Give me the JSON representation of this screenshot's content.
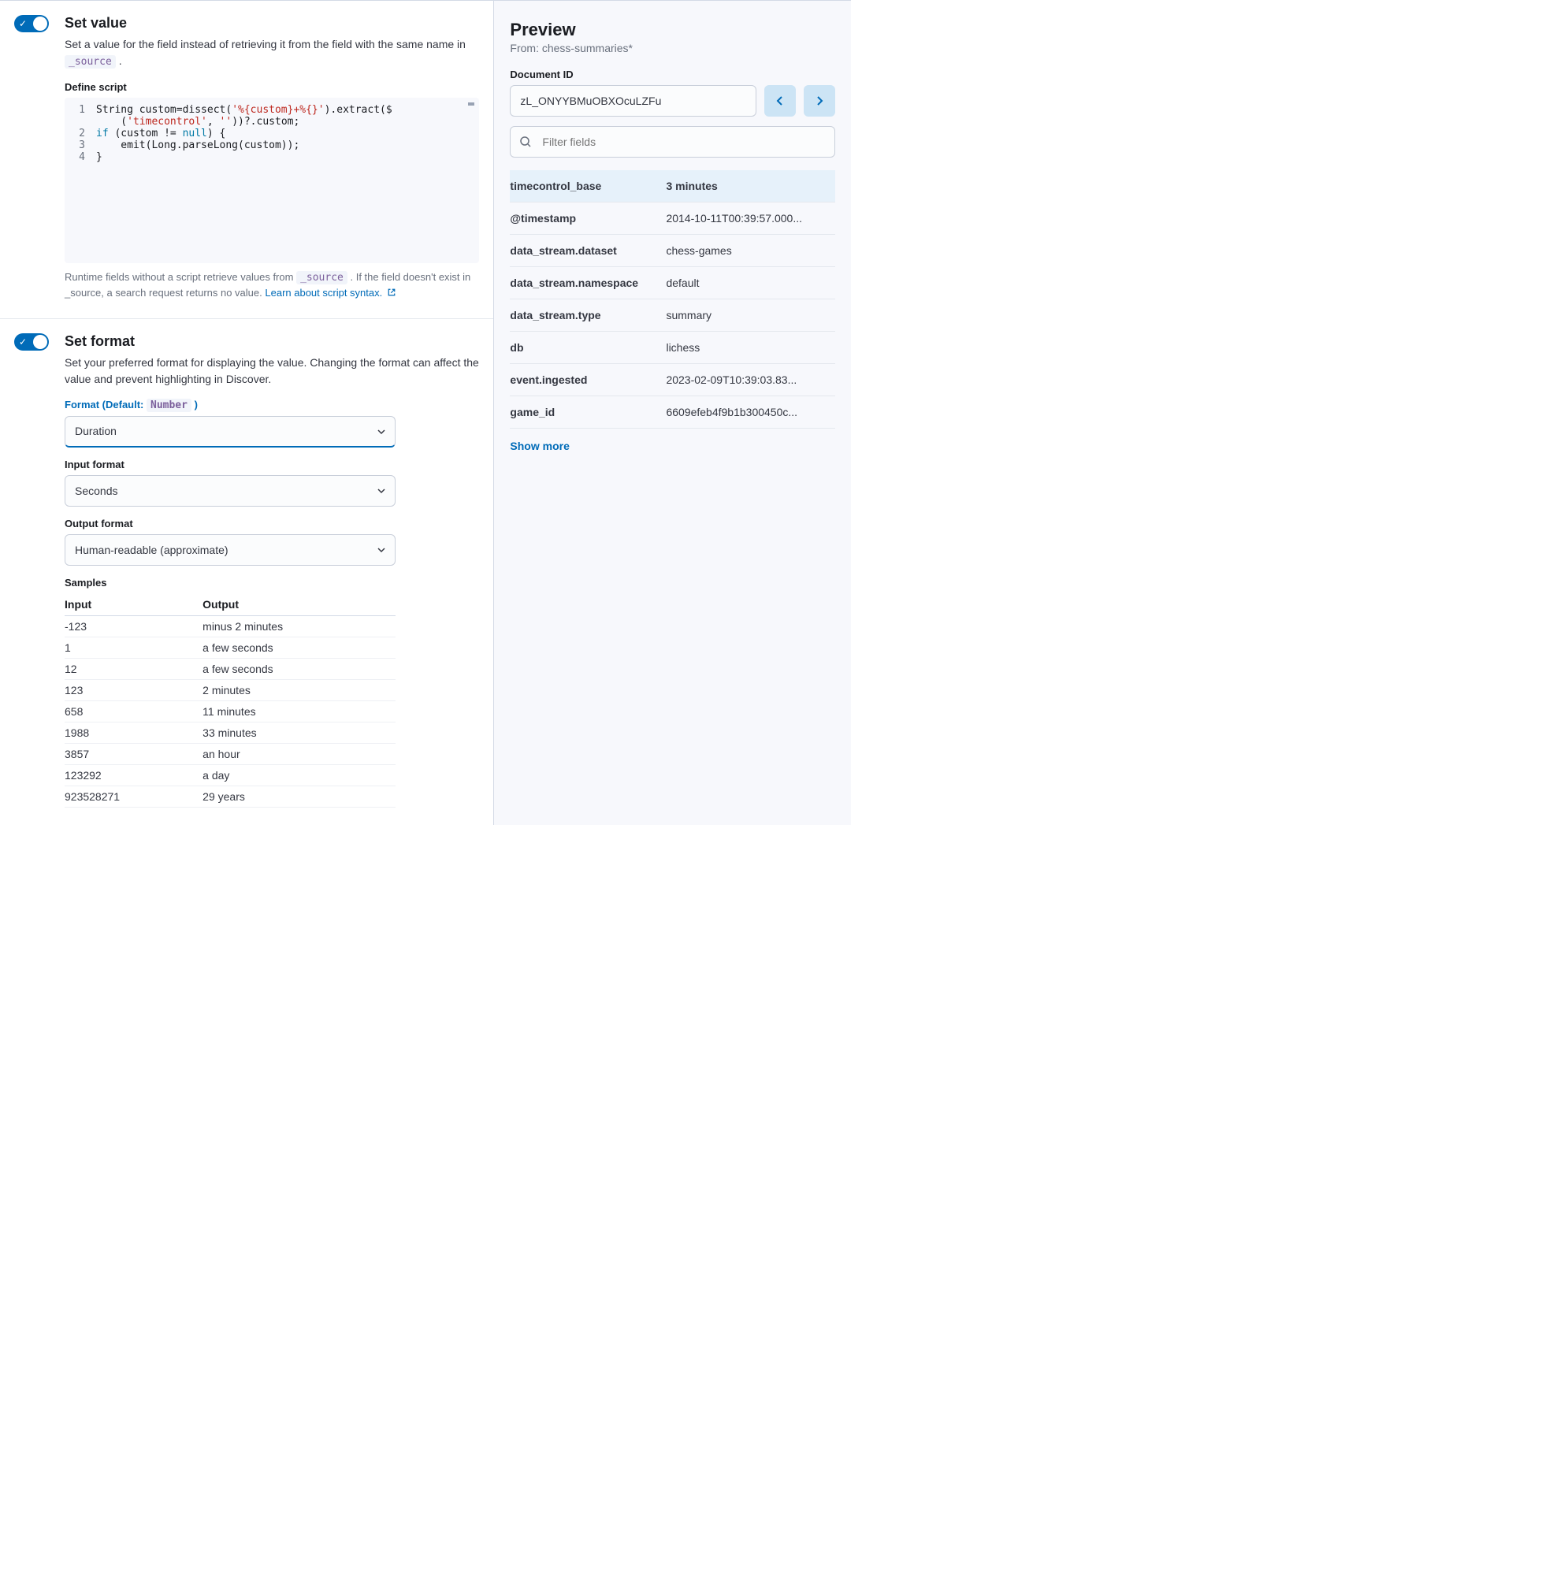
{
  "setValue": {
    "title": "Set value",
    "desc_pre": "Set a value for the field instead of retrieving it from the field with the same name in ",
    "desc_code": "_source",
    "desc_post": " .",
    "scriptLabel": "Define script",
    "code": {
      "l1a": "String custom=dissect(",
      "l1b": "'%{custom}+%{}'",
      "l1c": ").extract($",
      "l1_2a": "    (",
      "l1_2b": "'timecontrol'",
      "l1_2c": ", ",
      "l1_2d": "''",
      "l1_2e": "))?.custom;",
      "l2a": "if",
      "l2b": " (custom != ",
      "l2c": "null",
      "l2d": ") {",
      "l3": "    emit(Long.parseLong(custom));",
      "l4": "}"
    },
    "hint_pre": "Runtime fields without a script retrieve values from ",
    "hint_code": "_source",
    "hint_mid": " . If the field doesn't exist in _source, a search request returns no value. ",
    "hint_link": "Learn about script syntax."
  },
  "setFormat": {
    "title": "Set format",
    "desc": "Set your preferred format for displaying the value. Changing the format can affect the value and prevent highlighting in Discover.",
    "formatLabel_pre": "Format (Default: ",
    "formatLabel_code": "Number",
    "formatLabel_post": " )",
    "formatValue": "Duration",
    "inputFormatLabel": "Input format",
    "inputFormatValue": "Seconds",
    "outputFormatLabel": "Output format",
    "outputFormatValue": "Human-readable (approximate)",
    "samplesLabel": "Samples",
    "samplesHeaders": {
      "in": "Input",
      "out": "Output"
    },
    "samples": [
      {
        "in": "-123",
        "out": "minus 2 minutes"
      },
      {
        "in": "1",
        "out": "a few seconds"
      },
      {
        "in": "12",
        "out": "a few seconds"
      },
      {
        "in": "123",
        "out": "2 minutes"
      },
      {
        "in": "658",
        "out": "11 minutes"
      },
      {
        "in": "1988",
        "out": "33 minutes"
      },
      {
        "in": "3857",
        "out": "an hour"
      },
      {
        "in": "123292",
        "out": "a day"
      },
      {
        "in": "923528271",
        "out": "29 years"
      }
    ]
  },
  "preview": {
    "title": "Preview",
    "from": "From: chess-summaries*",
    "docIdLabel": "Document ID",
    "docId": "zL_ONYYBMuOBXOcuLZFu",
    "filterPlaceholder": "Filter fields",
    "highlightField": "timecontrol_base",
    "highlightValue": "3 minutes",
    "rows": [
      {
        "k": "@timestamp",
        "v": "2014-10-11T00:39:57.000..."
      },
      {
        "k": "data_stream.dataset",
        "v": "chess-games"
      },
      {
        "k": "data_stream.namespace",
        "v": "default"
      },
      {
        "k": "data_stream.type",
        "v": "summary"
      },
      {
        "k": "db",
        "v": "lichess"
      },
      {
        "k": "event.ingested",
        "v": "2023-02-09T10:39:03.83..."
      },
      {
        "k": "game_id",
        "v": "6609efeb4f9b1b300450c..."
      }
    ],
    "showMore": "Show more"
  }
}
